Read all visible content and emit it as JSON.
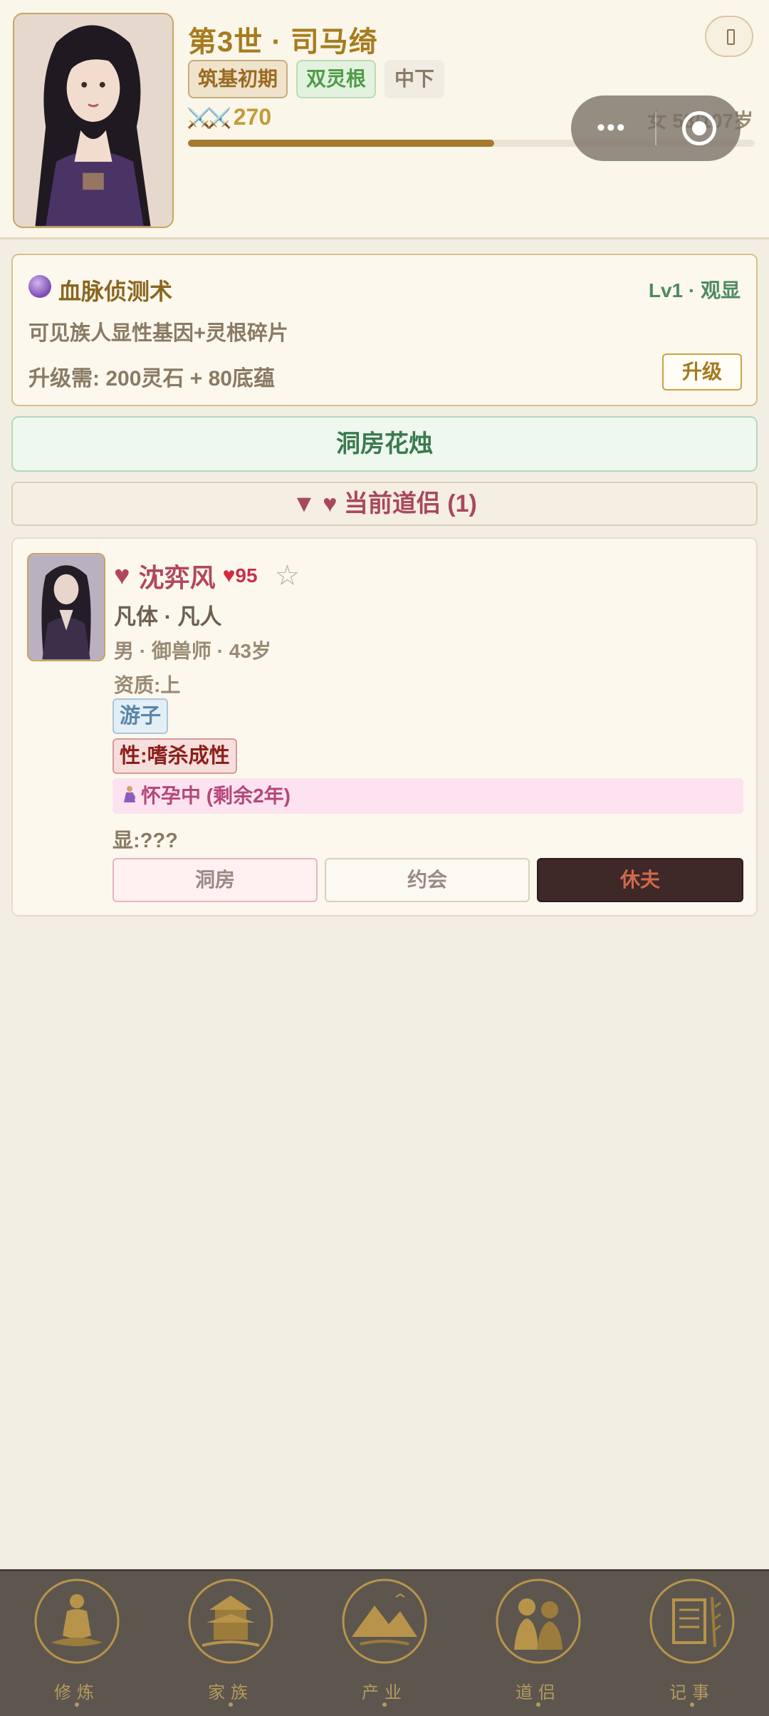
{
  "header": {
    "title": "第3世 · 司马绮",
    "tags": {
      "stage": "筑基初期",
      "root": "双灵根",
      "grade": "中下"
    },
    "power_icon": "crossed-swords-icon",
    "power_value": "270",
    "gender_age": "女 58/107岁",
    "life_progress": 0.54,
    "menu_icon": "menu-icon"
  },
  "skill": {
    "icon": "crystal-ball-icon",
    "name": "血脉侦测术",
    "level": "Lv1 · 观显",
    "description": "可见族人显性基因+灵根碎片",
    "cost": "升级需: 200灵石 + 80底蕴",
    "upgrade_label": "升级"
  },
  "bridal_button": "洞房花烛",
  "partners_section": {
    "label": "▼ ♥ 当前道侣 (1)"
  },
  "partner": {
    "name": "沈弈风",
    "affection": "95",
    "constitution": "凡体 · 凡人",
    "info": "男 · 御兽师 · 43岁",
    "aptitude": "资质:上",
    "trait": "游子",
    "nature": "性:嗜杀成性",
    "pregnancy": "怀孕中 (剩余2年)",
    "visible": "显:???",
    "buttons": {
      "bridal": "洞房",
      "date": "约会",
      "divorce": "休夫"
    }
  },
  "bottom_nav": [
    {
      "label": "修炼",
      "icon": "meditation-icon"
    },
    {
      "label": "家族",
      "icon": "pavilion-icon"
    },
    {
      "label": "产业",
      "icon": "mountain-icon"
    },
    {
      "label": "道侣",
      "icon": "couple-icon"
    },
    {
      "label": "记事",
      "icon": "scroll-icon"
    }
  ],
  "colors": {
    "accent_gold": "#a67c1e",
    "partner_red": "#b2475c",
    "success_green": "#3c7a4e",
    "nav_bg": "#5d564f"
  }
}
